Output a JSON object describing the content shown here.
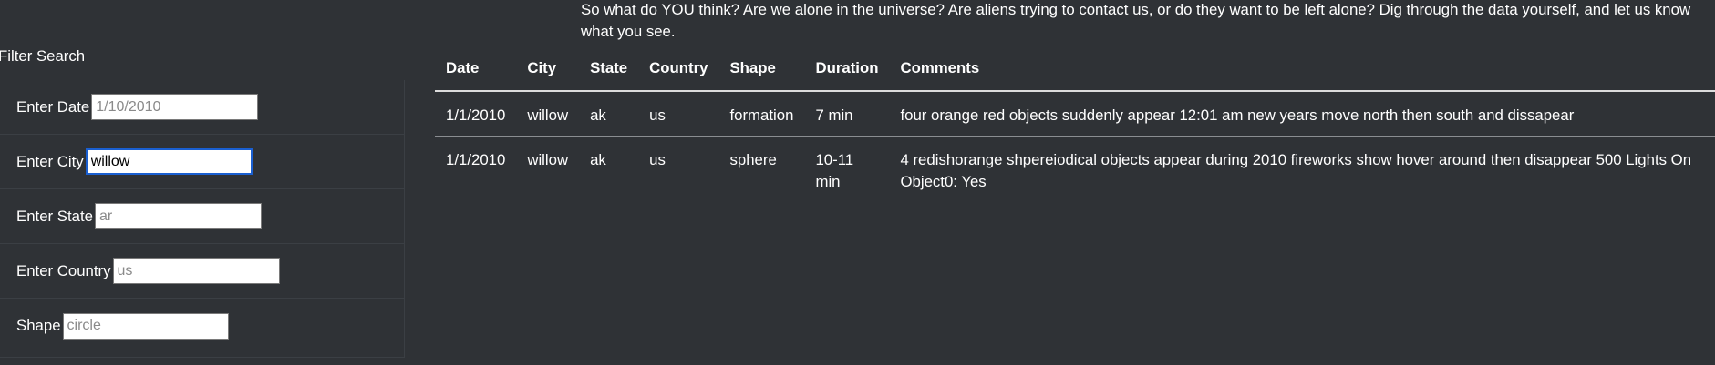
{
  "intro": {
    "text": "So what do YOU think? Are we alone in the universe? Are aliens trying to contact us, or do they want to be left alone? Dig through the data yourself, and let us know what you see."
  },
  "filter": {
    "title": "Filter Search",
    "fields": [
      {
        "label": "Enter Date",
        "value": "",
        "placeholder": "1/10/2010"
      },
      {
        "label": "Enter City",
        "value": "willow",
        "placeholder": ""
      },
      {
        "label": "Enter State",
        "value": "",
        "placeholder": "ar"
      },
      {
        "label": "Enter Country",
        "value": "",
        "placeholder": "us"
      },
      {
        "label": "Shape",
        "value": "",
        "placeholder": "circle"
      }
    ]
  },
  "table": {
    "headers": [
      "Date",
      "City",
      "State",
      "Country",
      "Shape",
      "Duration",
      "Comments"
    ],
    "rows": [
      [
        "1/1/2010",
        "willow",
        "ak",
        "us",
        "formation",
        "7 min",
        "four orange red objects suddenly appear 12:01 am new years move north then south and dissapear"
      ],
      [
        "1/1/2010",
        "willow",
        "ak",
        "us",
        "sphere",
        "10-11 min",
        "4 redishorange shpereiodical objects appear during 2010 fireworks show hover around then disappear 500 Lights On Object0: Yes"
      ]
    ]
  }
}
